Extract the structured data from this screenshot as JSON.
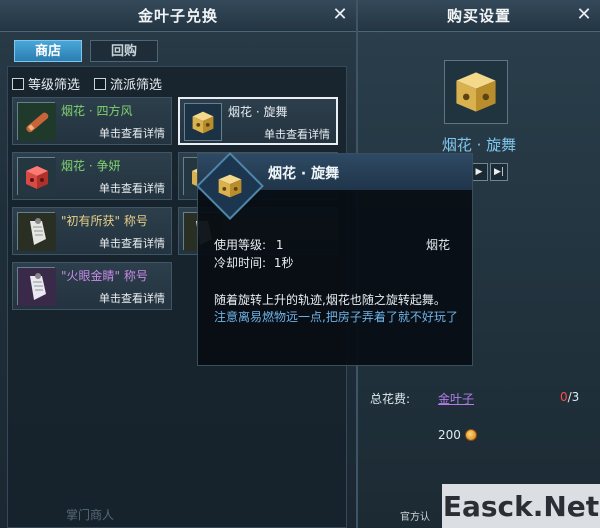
{
  "shop": {
    "title": "金叶子兑换",
    "tabs": [
      "商店",
      "回购"
    ],
    "filters": [
      "等级筛选",
      "流派筛选"
    ],
    "items": [
      {
        "name": "烟花 · 四方风",
        "detail": "单击查看详情",
        "icon": "firework-rocket-icon"
      },
      {
        "name": "烟花 · 旋舞",
        "detail": "单击查看详情",
        "icon": "firework-box-icon"
      },
      {
        "name": "烟花 · 争妍",
        "detail": "单击查看详情",
        "icon": "red-firework-box-icon"
      },
      {
        "name": "",
        "detail": "",
        "icon": "firework-box-icon"
      },
      {
        "name": "\"初有所获\" 称号",
        "detail": "单击查看详情",
        "icon": "title-scroll-icon"
      },
      {
        "name": "",
        "detail": "",
        "icon": "title-scroll-icon"
      },
      {
        "name": "\"火眼金睛\" 称号",
        "detail": "单击查看详情",
        "icon": "title-scroll-icon"
      }
    ],
    "footer": "掌门商人"
  },
  "purchase": {
    "title": "购买设置",
    "item_name": "烟花 · 旋舞",
    "qty_next": "▶",
    "qty_last": "▶|",
    "total_label": "总花费:",
    "currency": "金叶子",
    "owned": "0",
    "ratio_rest": "/3",
    "price": "200",
    "watermark": "Easck.Net",
    "watermark_sub": "官方认"
  },
  "tooltip": {
    "title": "烟花 · 旋舞",
    "level_label": "使用等级:",
    "level_value": "1",
    "type": "烟花",
    "cooldown_label": "冷却时间:",
    "cooldown_value": "1秒",
    "desc_line1": "随着旋转上升的轨迹,烟花也随之旋转起舞。",
    "desc_line2": "注意离易燃物远一点,把房子弄着了就不好玩了"
  }
}
